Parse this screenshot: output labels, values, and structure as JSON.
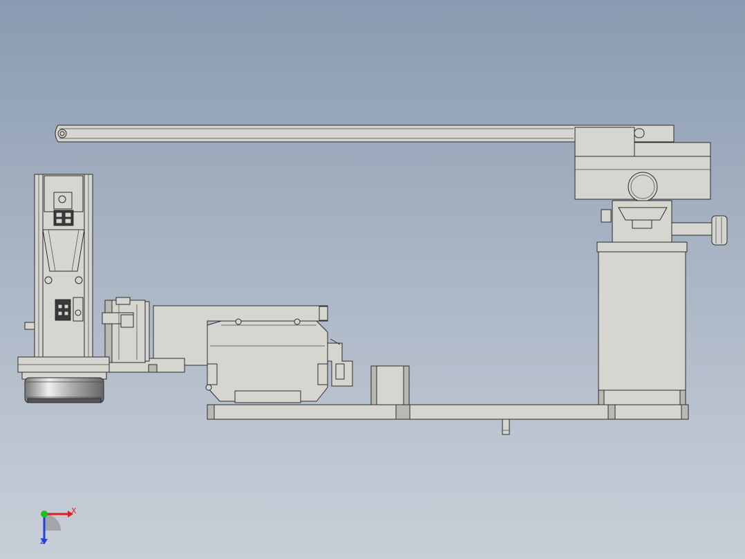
{
  "viewport": {
    "background_top": "#8a9ab0",
    "background_bottom": "#c9cfd8",
    "part_color": "#d6d5cf",
    "edge_color": "#2b2b2b"
  },
  "triad": {
    "x_label": "X",
    "z_label": "Z",
    "x_color": "#e02020",
    "z_color": "#2040e0",
    "y_color": "#20c020"
  }
}
